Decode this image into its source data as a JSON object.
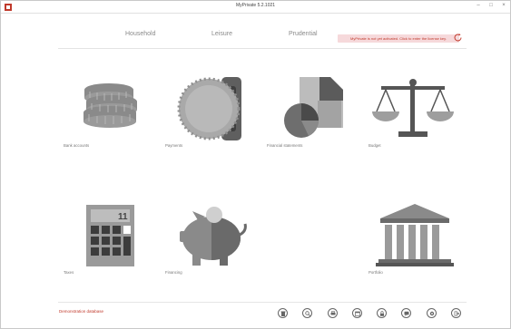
{
  "window": {
    "title": "MyPrivate 5.2.1021",
    "controls": {
      "minimize": "–",
      "maximize": "□",
      "close": "×"
    }
  },
  "tabs": [
    {
      "label": "Household"
    },
    {
      "label": "Leisure"
    },
    {
      "label": "Prudential"
    }
  ],
  "notice": {
    "text": "MyPrivate is not yet activated. Click to enter the license key."
  },
  "tiles": [
    {
      "label": "Bank accounts",
      "icon": "coins-stack-icon"
    },
    {
      "label": "Payments",
      "icon": "coin-slot-icon"
    },
    {
      "label": "Financial statements",
      "icon": "pie-chart-document-icon"
    },
    {
      "label": "Budget",
      "icon": "balance-scale-icon"
    },
    {
      "label": "Taxes",
      "icon": "calculator-icon"
    },
    {
      "label": "Financing",
      "icon": "piggy-bank-icon"
    },
    {
      "label": "Portfolio",
      "icon": "bank-building-icon"
    }
  ],
  "footer": {
    "database_label": "Demonstration database",
    "buttons": [
      "trash-icon",
      "search-icon",
      "print-icon",
      "calendar-icon",
      "lock-icon",
      "chat-icon",
      "settings-icon",
      "exit-icon"
    ]
  },
  "colors": {
    "accent": "#c0392b",
    "notice_bg": "#f6d9db",
    "icon_dark": "#6b6b6b",
    "icon_light": "#bdbdbd"
  }
}
